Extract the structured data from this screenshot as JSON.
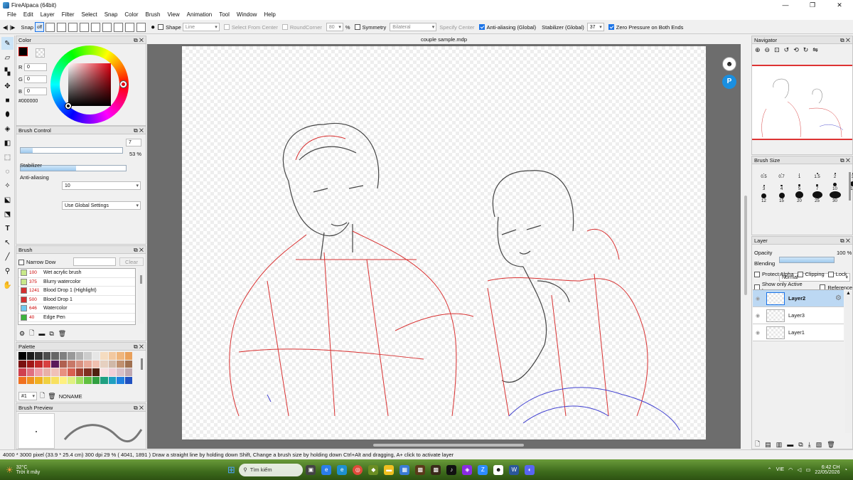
{
  "window": {
    "title": "FireAlpaca (64bit)",
    "min": "—",
    "max": "❐",
    "close": "✕"
  },
  "menu": [
    "File",
    "Edit",
    "Layer",
    "Filter",
    "Select",
    "Snap",
    "Color",
    "Brush",
    "View",
    "Animation",
    "Tool",
    "Window",
    "Help"
  ],
  "toolbar": {
    "snap_label": "Snap",
    "snap_off": "off",
    "shape_label": "Shape",
    "shape_value": "Line",
    "select_from_center": "Select From Center",
    "round_corner": "RoundCorner",
    "round_value": "80",
    "percent": "%",
    "symmetry_label": "Symmetry",
    "symmetry_value": "Bilateral",
    "specify_center": "Specify Center",
    "antialias": "Anti-aliasing (Global)",
    "stabilizer_label": "Stabilizer (Global)",
    "stabilizer_value": "37",
    "zero_pressure": "Zero Pressure on Both Ends"
  },
  "color_panel": {
    "title": "Color",
    "r_label": "R",
    "r": "0",
    "g_label": "G",
    "g": "0",
    "b_label": "B",
    "b": "0",
    "hex": "#000000",
    "fg": "#000000",
    "accent_red": "#d01010"
  },
  "brush_control": {
    "title": "Brush Control",
    "size": "7",
    "opacity": "53 %",
    "opacity_fraction": 0.53,
    "size_fraction": 0.12,
    "stabilizer_label": "Stabilizer",
    "stabilizer_value": "10",
    "aa_label": "Anti-aliasing",
    "aa_value": "Use Global Settings"
  },
  "brush_panel": {
    "title": "Brush",
    "narrow_down": "Narrow Dow",
    "clear": "Clear",
    "items": [
      {
        "num": "100",
        "name": "Wet acrylic brush",
        "color": "#c8e88a"
      },
      {
        "num": "375",
        "name": "Blurry watercolor",
        "color": "#c8e88a"
      },
      {
        "num": "1241",
        "name": "Blood Drop 1 (Highlight)",
        "color": "#d43030"
      },
      {
        "num": "500",
        "name": "Blood Drop 1",
        "color": "#d43030"
      },
      {
        "num": "646",
        "name": "Watercolor",
        "color": "#6ec8f0"
      },
      {
        "num": "40",
        "name": "Edge Pen",
        "color": "#3cb43c"
      }
    ]
  },
  "palette_panel": {
    "title": "Palette",
    "index": "#1",
    "name": "NONAME",
    "colors": [
      "#000000",
      "#1a1a1a",
      "#333333",
      "#4d4d4d",
      "#666666",
      "#808080",
      "#999999",
      "#b3b3b3",
      "#cccccc",
      "#e6e6e6",
      "#f5dcc0",
      "#f2c8a0",
      "#efb57c",
      "#e9a05a",
      "#7a1010",
      "#a01818",
      "#c02828",
      "#d84040",
      "#5a1a5a",
      "#b06050",
      "#c87868",
      "#d89080",
      "#e8a898",
      "#f0c0b0",
      "#e6d0c0",
      "#d0b8a8",
      "#c09070",
      "#a07050",
      "#d04050",
      "#e07080",
      "#f0a0a8",
      "#e8b0a8",
      "#f0c0b8",
      "#e89080",
      "#d86050",
      "#a04030",
      "#803020",
      "#502010",
      "#f8e0e0",
      "#f0d0d8",
      "#d8c0c8",
      "#c0a8b0",
      "#f07020",
      "#f09020",
      "#f0b020",
      "#f0d040",
      "#f8e060",
      "#fff080",
      "#e0f080",
      "#a0e060",
      "#60c040",
      "#30a040",
      "#20a080",
      "#20a0c0",
      "#2080e0",
      "#2050c0"
    ]
  },
  "preview_panel": {
    "title": "Brush Preview"
  },
  "canvas": {
    "tab": "couple sample.mdp"
  },
  "navigator": {
    "title": "Navigator"
  },
  "brush_size": {
    "title": "Brush Size",
    "sizes": [
      {
        "label": "0.5",
        "d": 1
      },
      {
        "label": "0.7",
        "d": 1
      },
      {
        "label": "1",
        "d": 1.5
      },
      {
        "label": "1.5",
        "d": 2
      },
      {
        "label": "2",
        "d": 2
      },
      {
        "label": "3",
        "d": 2
      },
      {
        "label": "3",
        "d": 2
      },
      {
        "label": "4",
        "d": 2.5
      },
      {
        "label": "5",
        "d": 3
      },
      {
        "label": "7",
        "d": 3.5
      },
      {
        "label": "10",
        "d": 5
      },
      {
        "label": "12",
        "d": 7
      },
      {
        "label": "12",
        "d": 7
      },
      {
        "label": "15",
        "d": 8
      },
      {
        "label": "20",
        "d": 11
      },
      {
        "label": "25",
        "d": 14
      },
      {
        "label": "30",
        "d": 16
      }
    ]
  },
  "layer_panel": {
    "title": "Layer",
    "opacity_label": "Opacity",
    "opacity_value": "100 %",
    "opacity_fraction": 1.0,
    "blending_label": "Blending",
    "blending_value": "Normal",
    "protect_alpha": "Protect Alpha",
    "clipping": "Clipping",
    "lock": "Lock",
    "show_only_active": "Show only Active Layer",
    "reference": "Reference",
    "layers": [
      {
        "name": "Layer2",
        "selected": true
      },
      {
        "name": "Layer3",
        "selected": false
      },
      {
        "name": "Layer1",
        "selected": false
      }
    ]
  },
  "status": "4000 * 3000 pixel   (33.9 * 25.4 cm)   300 dpi   29 %   ( 4041, 1891 )   Draw a straight line by holding down Shift, Change a brush size by holding down Ctrl+Alt and dragging, A+ click to activate layer",
  "taskbar": {
    "weather_temp": "32°C",
    "weather_desc": "Trời ít mây",
    "search": "Tìm kiếm",
    "lang": "VIE",
    "time": "6:42 CH",
    "date": "22/05/2026"
  }
}
